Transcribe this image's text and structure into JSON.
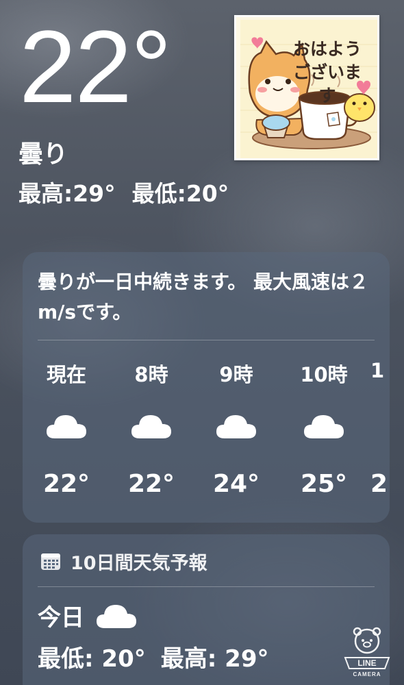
{
  "current": {
    "temperature": "22°",
    "condition": "曇り",
    "high": "最高:29°",
    "low": "最低:20°"
  },
  "sticker": {
    "text": "おはようございます"
  },
  "hourly": {
    "summary": "曇りが一日中続きます。 最大風速は２m/sです。",
    "items": [
      {
        "label": "現在",
        "icon": "cloud-icon",
        "temp": "22°"
      },
      {
        "label": "8時",
        "icon": "cloud-icon",
        "temp": "22°"
      },
      {
        "label": "9時",
        "icon": "cloud-icon",
        "temp": "24°"
      },
      {
        "label": "10時",
        "icon": "cloud-icon",
        "temp": "25°"
      },
      {
        "label": "1",
        "icon": "cloud-icon",
        "temp": "2"
      }
    ]
  },
  "daily": {
    "header": "10日間天気予報",
    "header_icon": "calendar-icon",
    "today": {
      "label": "今日",
      "icon": "cloud-icon",
      "low": "最低: 20°",
      "high": "最高: 29°"
    }
  },
  "badge": {
    "text_top": "LINE",
    "text_bottom": "CAMERA"
  }
}
